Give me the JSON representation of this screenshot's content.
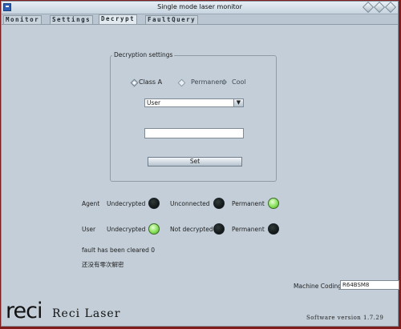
{
  "window": {
    "title": "Single mode laser monitor"
  },
  "tabs": [
    {
      "label": "Monitor"
    },
    {
      "label": "Settings"
    },
    {
      "label": "Decrypt"
    },
    {
      "label": "FaultQuery"
    }
  ],
  "active_tab": "Decrypt",
  "decryption": {
    "group_title": "Decryption settings",
    "radio_class_a": "Class A",
    "radio_permanent": "Permanent",
    "radio_cool": "Cool",
    "select_value": "User",
    "text_input_value": "",
    "set_button": "Set"
  },
  "status": {
    "agent_label": "Agent",
    "user_label": "User",
    "row1": [
      {
        "label": "Undecrypted",
        "state": "off"
      },
      {
        "label": "Unconnected",
        "state": "off"
      },
      {
        "label": "Permanent",
        "state": "on"
      }
    ],
    "row2": [
      {
        "label": "Undecrypted",
        "state": "on"
      },
      {
        "label": "Not decrypted",
        "state": "off"
      },
      {
        "label": "Permanent",
        "state": "off"
      }
    ]
  },
  "messages": {
    "fault_cleared": "fault has been cleared 0",
    "chinese_note": "还没有零次解密"
  },
  "machine": {
    "label": "Machine Coding",
    "value": "R64BSM8"
  },
  "brand": {
    "logo_text": "reci",
    "name": "Reci Laser"
  },
  "software": {
    "version_text": "Software version  1.7.29"
  },
  "colors": {
    "window_bg": "#c3ced8",
    "led_on": "#88e05a",
    "led_off": "#1f2726",
    "frame": "#7f1d1d"
  }
}
